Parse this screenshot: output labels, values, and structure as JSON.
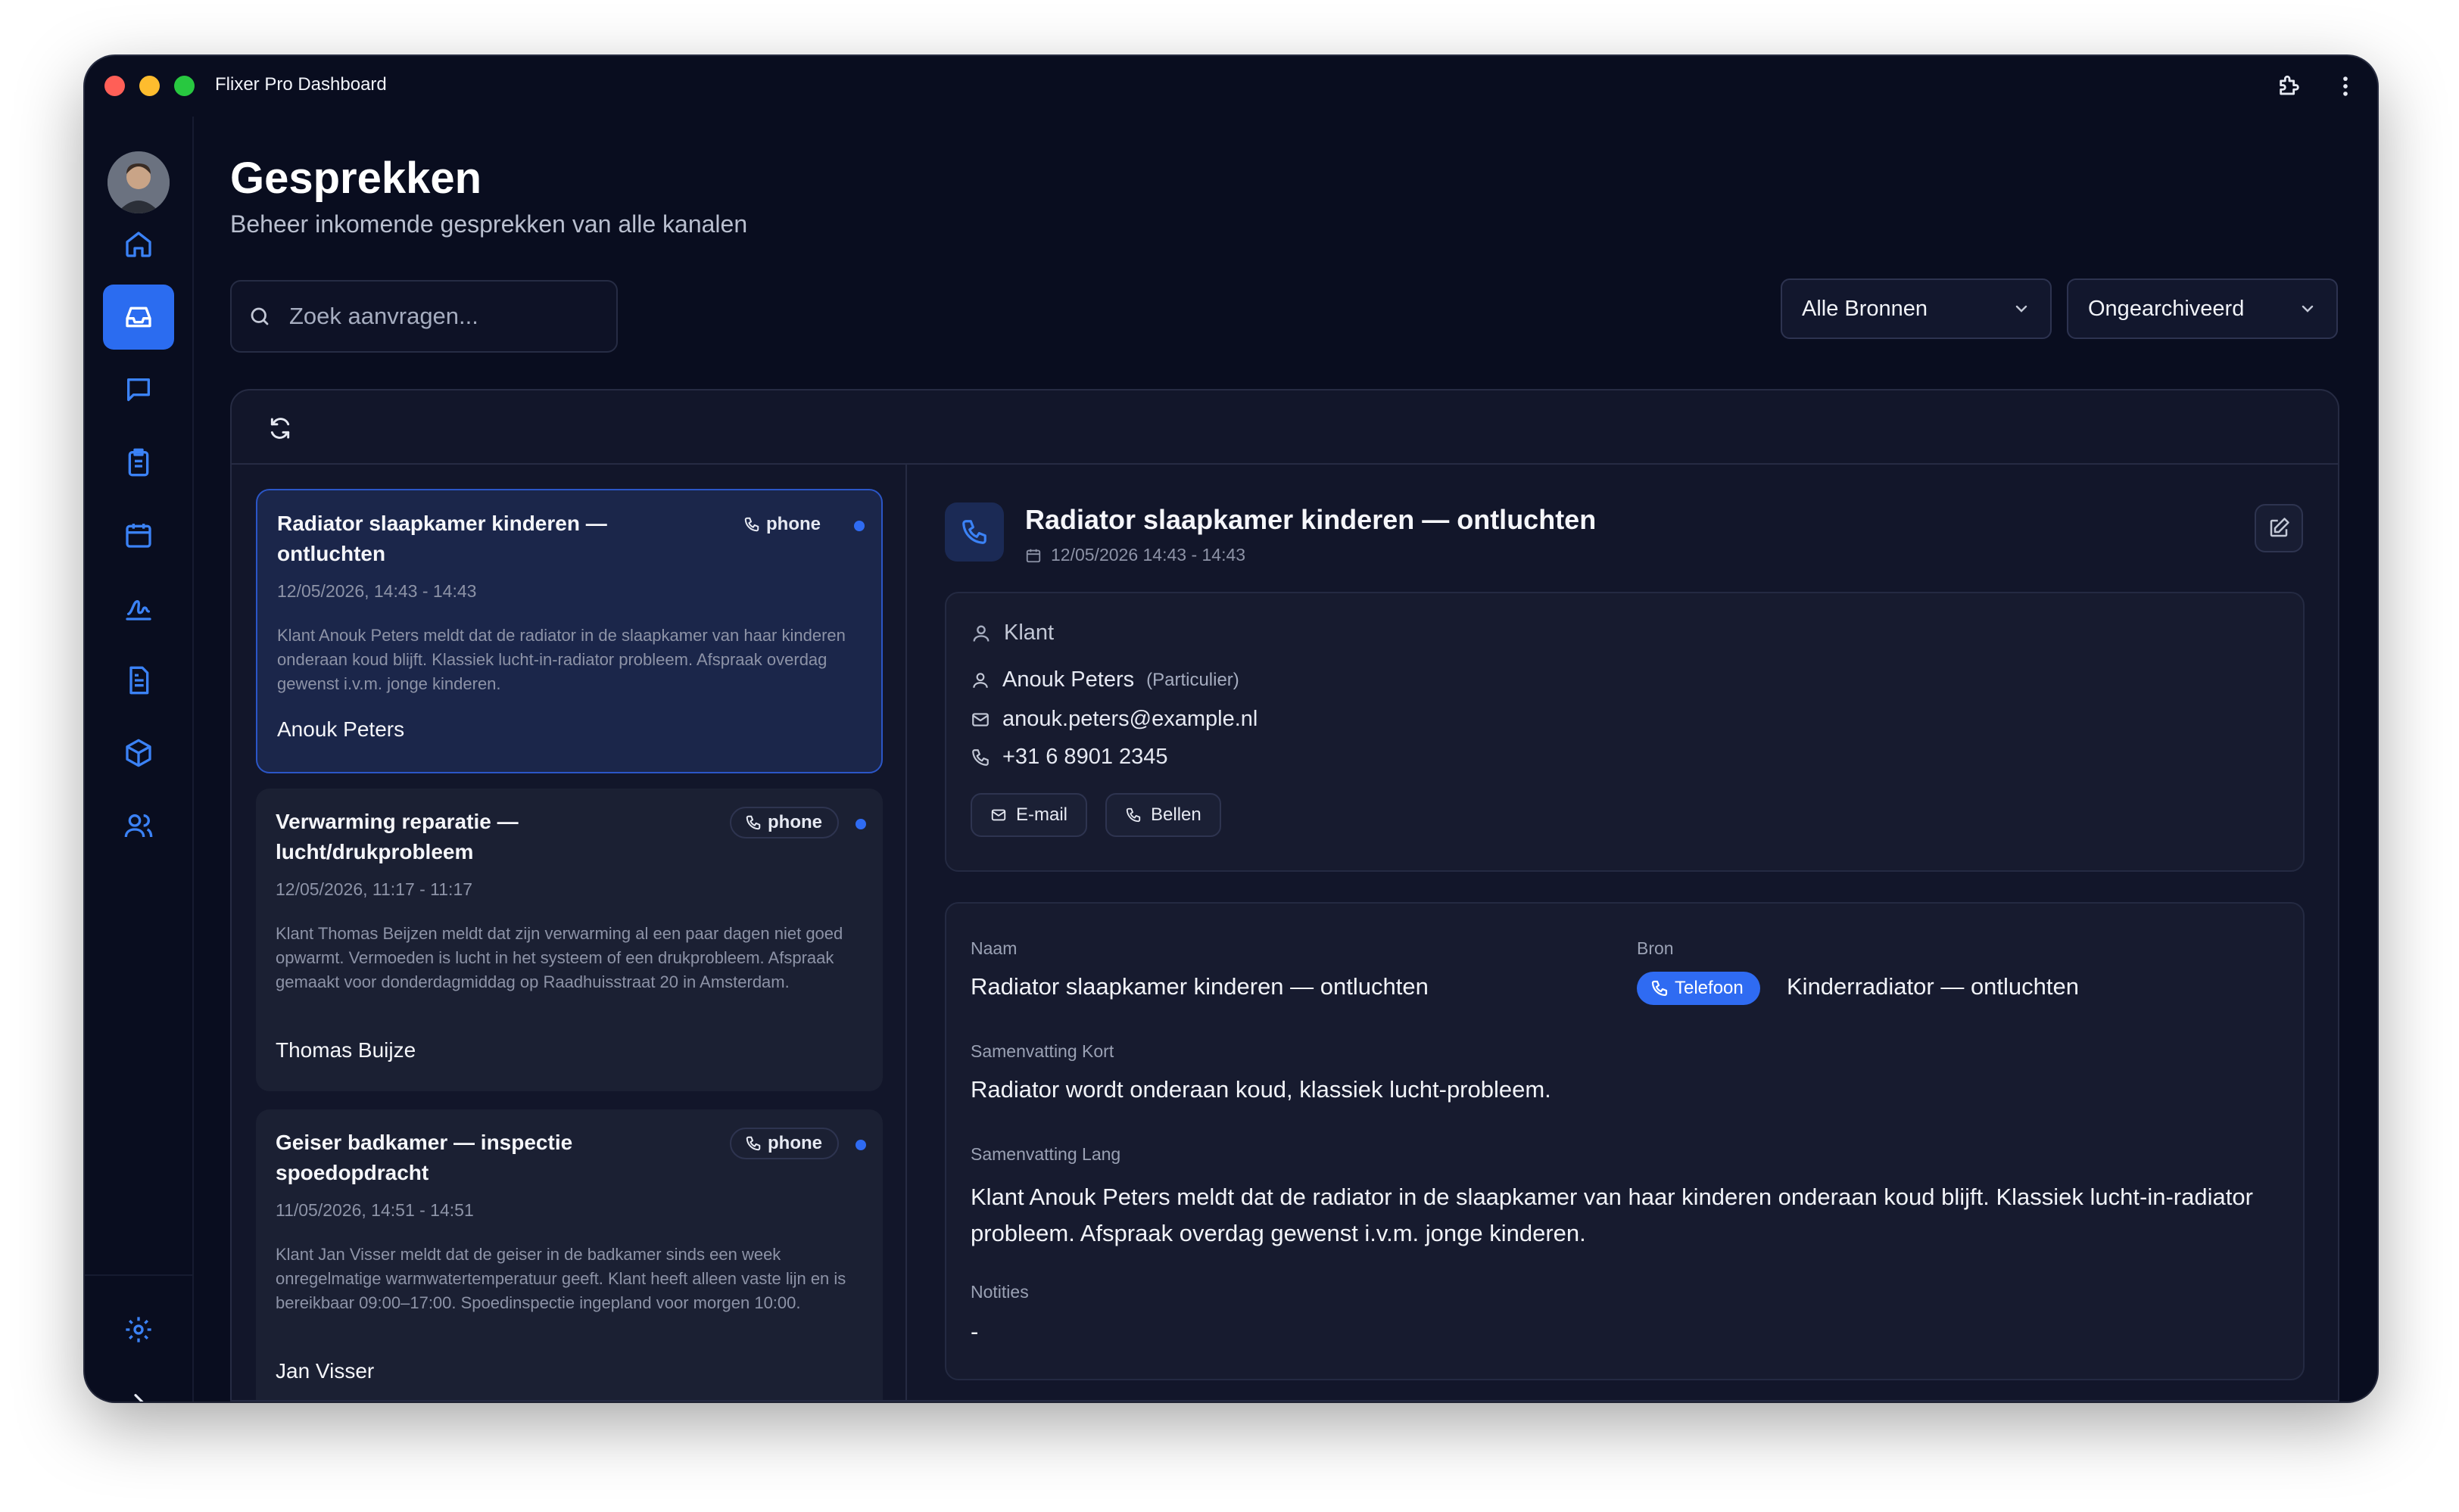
{
  "app": {
    "title": "Flixer Pro Dashboard"
  },
  "header": {
    "title": "Gesprekken",
    "subtitle": "Beheer inkomende gesprekken van alle kanalen"
  },
  "search": {
    "placeholder": "Zoek aanvragen...",
    "value": ""
  },
  "filters": {
    "sources": "Alle Bronnen",
    "archive": "Ongearchiveerd"
  },
  "sidebar": {
    "items": [
      {
        "name": "home-icon",
        "active": false
      },
      {
        "name": "inbox-icon",
        "active": true
      },
      {
        "name": "chat-icon",
        "active": false
      },
      {
        "name": "clipboard-icon",
        "active": false
      },
      {
        "name": "calendar-icon",
        "active": false
      },
      {
        "name": "signature-icon",
        "active": false
      },
      {
        "name": "document-icon",
        "active": false
      },
      {
        "name": "package-icon",
        "active": false
      },
      {
        "name": "users-icon",
        "active": false
      }
    ]
  },
  "conversations": [
    {
      "title": "Radiator slaapkamer kinderen — ontluchten",
      "badge": "phone",
      "time": "12/05/2026, 14:43 - 14:43",
      "body": "Klant Anouk Peters meldt dat de radiator in de slaapkamer van haar kinderen onderaan koud blijft. Klassiek lucht-in-radiator probleem. Afspraak overdag gewenst i.v.m. jonge kinderen.",
      "name": "Anouk Peters"
    },
    {
      "title": "Verwarming reparatie — lucht/drukprobleem",
      "badge": "phone",
      "time": "12/05/2026, 11:17 - 11:17",
      "body": "Klant Thomas Beijzen meldt dat zijn verwarming al een paar dagen niet goed opwarmt. Vermoeden is lucht in het systeem of een drukprobleem. Afspraak gemaakt voor donderdagmiddag op Raadhuisstraat 20 in Amsterdam.",
      "name": "Thomas Buijze"
    },
    {
      "title": "Geiser badkamer — inspectie spoedopdracht",
      "badge": "phone",
      "time": "11/05/2026, 14:51 - 14:51",
      "body": "Klant Jan Visser meldt dat de geiser in de badkamer sinds een week onregelmatige warmwatertemperatuur geeft. Klant heeft alleen vaste lijn en is bereikbaar 09:00–17:00. Spoedinspectie ingepland voor morgen 10:00.",
      "name": "Jan Visser"
    }
  ],
  "detail": {
    "title": "Radiator slaapkamer kinderen — ontluchten",
    "date": "12/05/2026 14:43 - 14:43",
    "client": {
      "heading": "Klant",
      "name": "Anouk Peters",
      "type": "(Particulier)",
      "email": "anouk.peters@example.nl",
      "phone": "+31 6 8901 2345",
      "email_button": "E-mail",
      "call_button": "Bellen"
    },
    "info": {
      "name_label": "Naam",
      "name_value": "Radiator slaapkamer kinderen — ontluchten",
      "source_label": "Bron",
      "source_badge": "Telefoon",
      "source_value": "Kinderradiator — ontluchten",
      "short_label": "Samenvatting Kort",
      "short_value": "Radiator wordt onderaan koud, klassiek lucht-probleem.",
      "long_label": "Samenvatting Lang",
      "long_value": "Klant Anouk Peters meldt dat de radiator in de slaapkamer van haar kinderen onderaan koud blijft. Klassiek lucht-in-radiator probleem. Afspraak overdag gewenst i.v.m. jonge kinderen.",
      "notes_label": "Notities",
      "notes_value": "-"
    }
  },
  "colors": {
    "accent": "#2f6bf2",
    "background": "#090d1f",
    "panel": "#12162a"
  }
}
